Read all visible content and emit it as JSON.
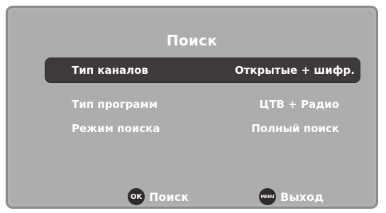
{
  "dialog": {
    "title": "Поиск"
  },
  "settings": [
    {
      "label": "Тип каналов",
      "value": "Открытые + шифр.",
      "selected": true
    },
    {
      "label": "Тип программ",
      "value": "ЦТВ + Радио",
      "selected": false
    },
    {
      "label": "Режим поиска",
      "value": "Полный поиск",
      "selected": false
    }
  ],
  "footer": {
    "ok": {
      "key_label": "OK",
      "label": "Поиск",
      "icon": "ok-key-icon"
    },
    "menu": {
      "key_label": "MENU",
      "label": "Выход",
      "icon": "menu-key-icon"
    }
  },
  "colors": {
    "panel": "#adadad",
    "border": "#8a8a8a",
    "highlight": "#3f3a3a",
    "text": "#ffffff"
  }
}
